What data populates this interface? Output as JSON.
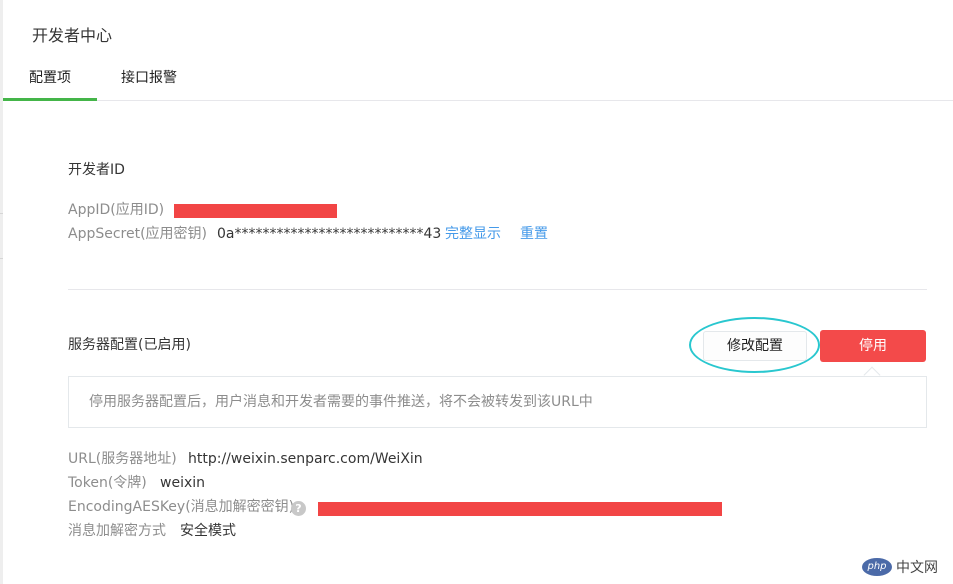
{
  "page": {
    "title": "开发者中心"
  },
  "tabs": [
    {
      "label": "配置项",
      "active": true
    },
    {
      "label": "接口报警",
      "active": false
    }
  ],
  "developer_id": {
    "heading": "开发者ID",
    "appid_label": "AppID(应用ID)",
    "appsecret_label": "AppSecret(应用密钥)",
    "appsecret_value": "0a***************************43",
    "show_full_link": "完整显示",
    "reset_link": "重置"
  },
  "server_config": {
    "heading": "服务器配置(已启用)",
    "modify_button": "修改配置",
    "disable_button": "停用",
    "tooltip": "停用服务器配置后，用户消息和开发者需要的事件推送，将不会被转发到该URL中",
    "url_label": "URL(服务器地址)",
    "url_value": "http://weixin.senparc.com/WeiXin",
    "token_label": "Token(令牌)",
    "token_value": "weixin",
    "aeskey_label": "EncodingAESKey(消息加解密密钥)",
    "encrypt_mode_label": "消息加解密方式",
    "encrypt_mode_value": "安全模式"
  },
  "watermark": {
    "logo": "php",
    "text": "中文网"
  },
  "colors": {
    "accent_green": "#44b549",
    "link_blue": "#459ae9",
    "danger_red": "#f34a4a",
    "highlight_cyan": "#29c7cf",
    "redaction_red": "#f24545"
  },
  "icons": {
    "help": "question-circle-icon"
  }
}
